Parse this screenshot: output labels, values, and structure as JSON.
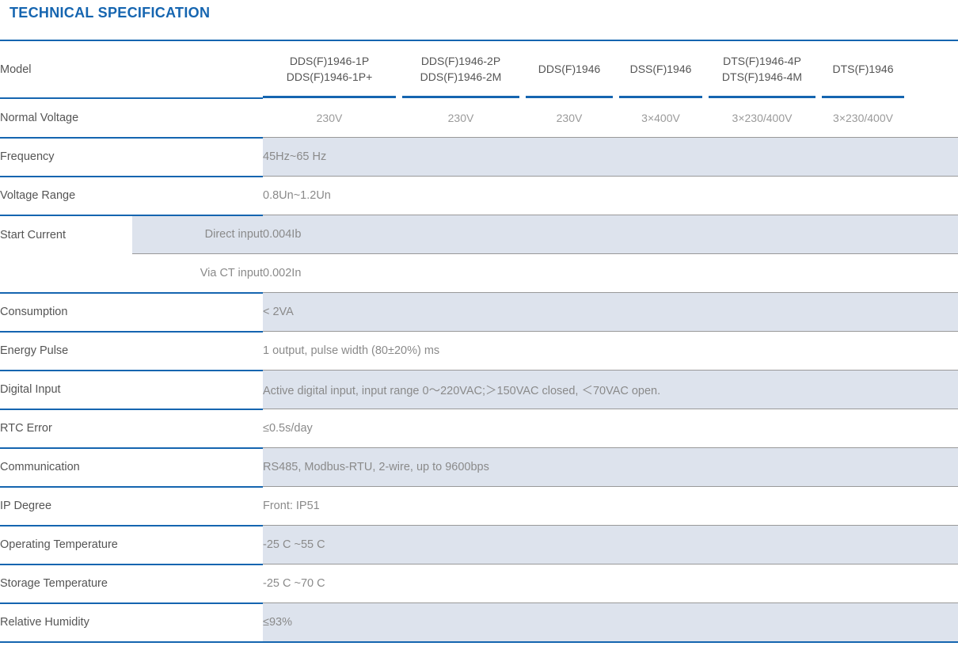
{
  "document": {
    "title": "TECHNICAL SPECIFICATION"
  },
  "colors": {
    "accent_blue": "#1565b0",
    "shade_blue": "#dde3ed",
    "label_gray": "#555555",
    "value_gray": "#8a8a8a"
  },
  "table": {
    "model_header_label": "Model",
    "models": [
      {
        "line1": "DDS(F)1946-1P",
        "line2": "DDS(F)1946-1P+"
      },
      {
        "line1": "DDS(F)1946-2P",
        "line2": "DDS(F)1946-2M"
      },
      {
        "line1": "DDS(F)1946",
        "line2": ""
      },
      {
        "line1": "DSS(F)1946",
        "line2": ""
      },
      {
        "line1": "DTS(F)1946-4P",
        "line2": "DTS(F)1946-4M"
      },
      {
        "line1": "DTS(F)1946",
        "line2": ""
      }
    ],
    "normal_voltage": {
      "label": "Normal Voltage",
      "values": [
        "230V",
        "230V",
        "230V",
        "3×400V",
        "3×230/400V",
        "3×230/400V"
      ]
    },
    "rows": [
      {
        "label": "Frequency",
        "value": "45Hz~65 Hz",
        "shaded": true
      },
      {
        "label": "Voltage Range",
        "value": "0.8Un~1.2Un",
        "shaded": false
      },
      {
        "label": "Start Current",
        "sublabel": "Direct input",
        "value": "0.004Ib",
        "shaded": true
      },
      {
        "label": "",
        "sublabel": "Via CT input",
        "value": "0.002In",
        "shaded": false
      },
      {
        "label": "Consumption",
        "value": "< 2VA",
        "shaded": true
      },
      {
        "label": "Energy Pulse",
        "value": "1 output, pulse width (80±20%) ms",
        "shaded": false
      },
      {
        "label": "Digital Input",
        "value": "Active digital input, input range 0～220VAC;＞150VAC closed, ＜70VAC open.",
        "shaded": true
      },
      {
        "label": "RTC Error",
        "value": "≤0.5s/day",
        "shaded": false
      },
      {
        "label": "Communication",
        "value": "RS485, Modbus-RTU, 2-wire, up to 9600bps",
        "shaded": true
      },
      {
        "label": "IP Degree",
        "value": "Front: IP51",
        "shaded": false
      },
      {
        "label": "Operating Temperature",
        "value": "-25 C ~55 C",
        "shaded": true
      },
      {
        "label": "Storage Temperature",
        "value": "-25 C ~70 C",
        "shaded": false
      },
      {
        "label": "Relative Humidity",
        "value": "≤93%",
        "shaded": true
      }
    ]
  }
}
